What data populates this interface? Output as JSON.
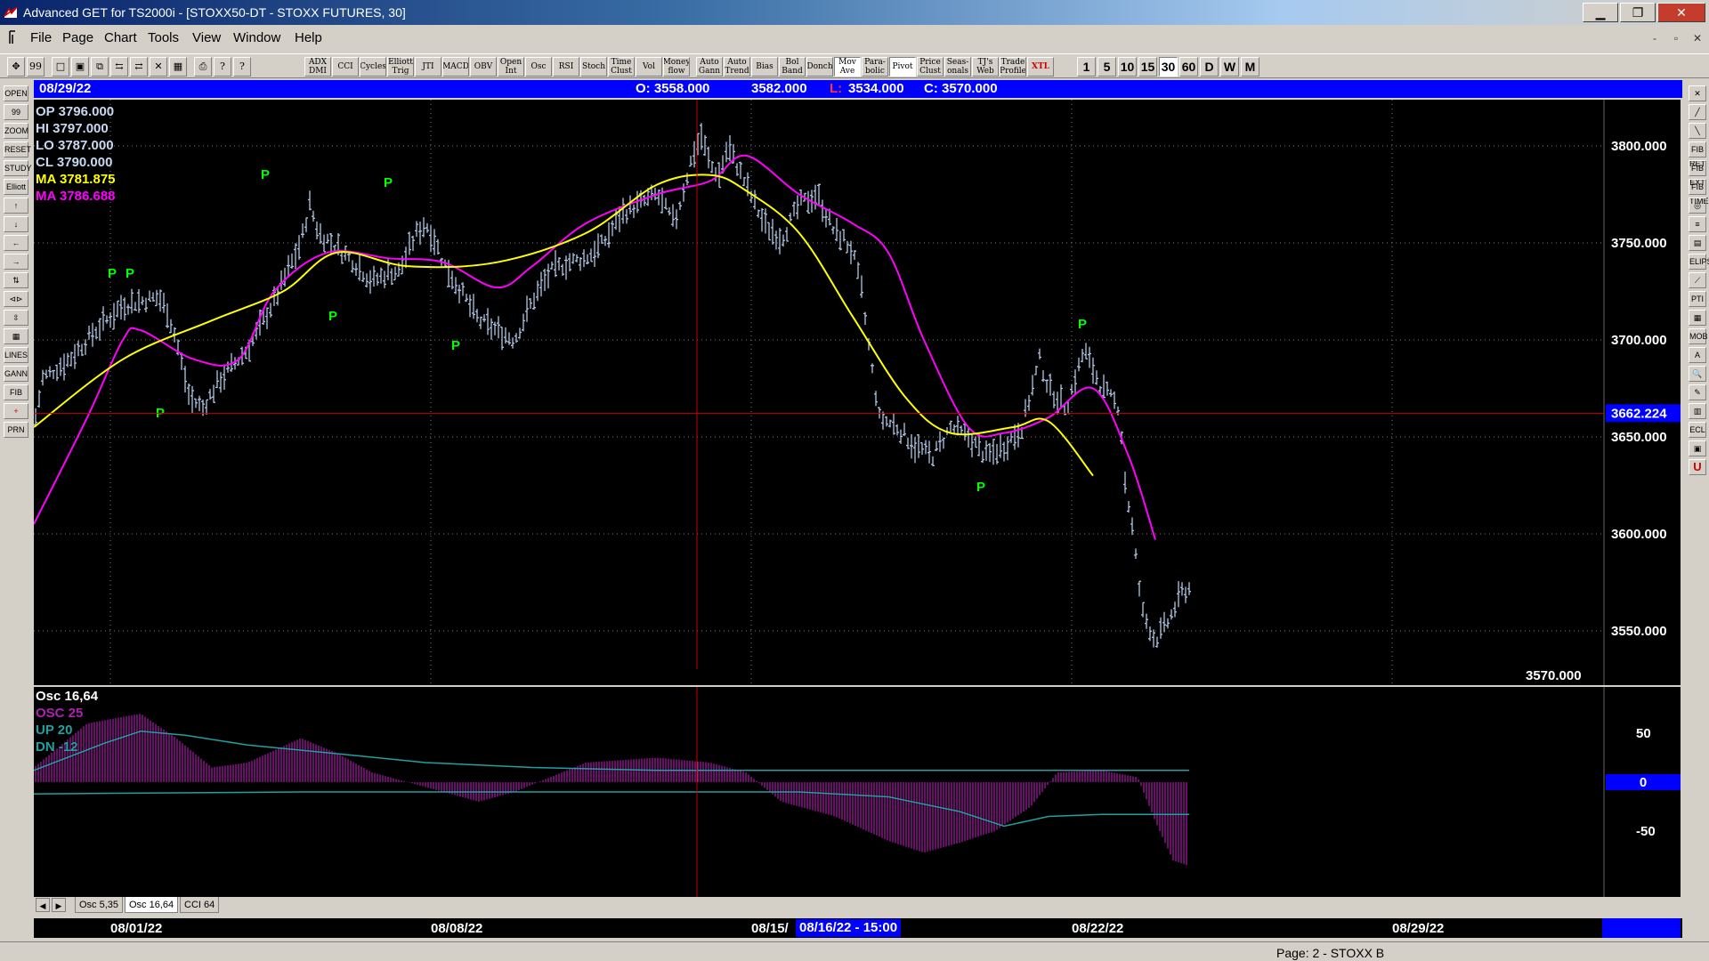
{
  "window": {
    "title": "Advanced GET for TS2000i - [STOXX50-DT - STOXX FUTURES, 30]",
    "minimize_label": "▁",
    "restore_label": "❐",
    "close_label": "✕"
  },
  "menu": {
    "items": [
      "File",
      "Page",
      "Chart",
      "Tools",
      "View",
      "Window",
      "Help"
    ],
    "mdi_buttons": [
      "-",
      "▫",
      "✕"
    ]
  },
  "toolbar": {
    "indicator_buttons": [
      "ADX DMI",
      "CCI",
      "Cycles",
      "Elliott Trig",
      "JTI",
      "MACD",
      "OBV",
      "Open Int",
      "Osc",
      "RSI",
      "Stoch",
      "Time Clust",
      "Vol",
      "Money flow",
      "Auto Gann",
      "Auto Trend",
      "Bias",
      "Bol Band",
      "Donch",
      "Mov Ave",
      "Para-bolic",
      "Pivot",
      "Price Clust",
      "Seas-onals",
      "TJ's Web",
      "Trade Profile",
      "XTL"
    ],
    "timeframes": [
      "1",
      "5",
      "10",
      "15",
      "30",
      "60",
      "D",
      "W",
      "M"
    ],
    "active_timeframe": "30"
  },
  "left_tools": [
    "OPEN",
    "99",
    "ZOOM",
    "RESET",
    "STUDY",
    "Elliott",
    "↑",
    "↓",
    "←",
    "→",
    "⇅",
    "⊲⊳",
    "⇳",
    "▦",
    "LINES",
    "GANN",
    "FIB",
    "+",
    "PRN"
  ],
  "right_tools": [
    "✕",
    "╱",
    "╲",
    "FIB RET",
    "FIB EXT",
    "FIB TIME",
    "◎",
    "≡",
    "▤",
    "ELIPS",
    "⟋",
    "PTI",
    "▦",
    "MOB",
    "A",
    "🔍",
    "✎",
    "▥",
    "ECL",
    "▣",
    "U"
  ],
  "info_bar": {
    "date": "08/29/22",
    "open": "O: 3558.000",
    "high": "3582.000",
    "low_label": "L:",
    "low": "3534.000",
    "close": "C: 3570.000"
  },
  "readout": {
    "op": "OP  3796.000",
    "hi": "HI   3797.000",
    "lo": "LO  3787.000",
    "cl": "CL  3790.000",
    "ma1": "MA  3781.875",
    "ma2": "MA  3786.688"
  },
  "price_axis": {
    "labels": [
      "3800.000",
      "3750.000",
      "3700.000",
      "3650.000",
      "3600.000",
      "3550.000"
    ],
    "cursor_price": "3662.224",
    "last_price": "3570.000"
  },
  "pivot_label": "P",
  "osc_panel": {
    "title": "Osc 16,64",
    "osc": "OSC 25",
    "up": "UP   20",
    "dn": "DN   -12",
    "axis_labels": [
      "50",
      "0",
      "-50"
    ]
  },
  "tabs": [
    "Osc 5,35",
    "Osc 16,64",
    "CCI 64"
  ],
  "active_tab": "Osc 16,64",
  "date_axis": {
    "labels": [
      "08/01/22",
      "08/08/22",
      "08/15/",
      "08/22/22",
      "08/29/22"
    ],
    "cursor_date": "08/16/22 - 15:00"
  },
  "status": {
    "page": "Page: 2 - STOXX B"
  },
  "colors": {
    "price_bars": "#b0c8e8",
    "ma_fast": "#ffff00",
    "ma_slow": "#ff00ff",
    "pivot": "#00ff00",
    "cursor": "#cc0000",
    "osc_histogram": "#d020d0",
    "osc_bands": "#20a0a0",
    "info_bar": "#0000ff"
  }
}
